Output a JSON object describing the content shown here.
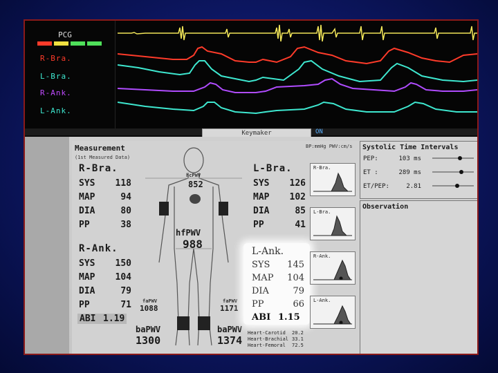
{
  "monitor": {
    "channel_title": "PCG",
    "channels": [
      {
        "label": "R-Bra.",
        "color": "#ff3b2a"
      },
      {
        "label": "L-Bra.",
        "color": "#3ee8d0"
      },
      {
        "label": "R-Ank.",
        "color": "#c04bff"
      },
      {
        "label": "L-Ank.",
        "color": "#3ee8d0"
      }
    ],
    "toolbar_text": "Keymaker",
    "toolbar_status": "ON"
  },
  "report": {
    "measurement_title": "Measurement",
    "measurement_sub": "(1st Measured Data)",
    "units": "BP:mmHg PWV:cm/s",
    "r_bra": {
      "title": "R-Bra.",
      "rows": [
        [
          "SYS",
          "118"
        ],
        [
          "MAP",
          "94"
        ],
        [
          "DIA",
          "80"
        ],
        [
          "PP",
          "38"
        ]
      ]
    },
    "r_ank": {
      "title": "R-Ank.",
      "rows": [
        [
          "SYS",
          "150"
        ],
        [
          "MAP",
          "104"
        ],
        [
          "DIA",
          "79"
        ],
        [
          "PP",
          "71"
        ]
      ],
      "abi_label": "ABI",
      "abi_value": "1.19"
    },
    "l_bra": {
      "title": "L-Bra.",
      "rows": [
        [
          "SYS",
          "126"
        ],
        [
          "MAP",
          "102"
        ],
        [
          "DIA",
          "85"
        ],
        [
          "PP",
          "41"
        ]
      ]
    },
    "l_ank": {
      "title": "L-Ank.",
      "rows": [
        [
          "SYS",
          "145"
        ],
        [
          "MAP",
          "104"
        ],
        [
          "DIA",
          "79"
        ],
        [
          "PP",
          "66"
        ]
      ],
      "abi_label": "ABI",
      "abi_value": "1.15"
    },
    "pwv": {
      "hcPWV": {
        "label": "hcPWV",
        "value": "852"
      },
      "hfPWV": {
        "label": "hfPWV",
        "value": "988"
      },
      "faPWV_r": {
        "label": "faPWV",
        "value": "1088"
      },
      "faPWV_l": {
        "label": "faPWV",
        "value": "1171"
      },
      "baPWV_r": {
        "label": "baPWV",
        "value": "1300"
      },
      "baPWV_l": {
        "label": "baPWV",
        "value": "1374"
      }
    },
    "graphs": [
      "R-Bra.",
      "L-Bra.",
      "R-Ank.",
      "L-Ank."
    ],
    "sti": {
      "title": "Systolic Time Intervals",
      "rows": [
        [
          "PEP:",
          "103 ms"
        ],
        [
          "ET :",
          "289 ms"
        ],
        [
          "ET/PEP:",
          "2.81"
        ]
      ]
    },
    "observation_title": "Observation",
    "distances": [
      [
        "Heart-Carotid",
        "20.2"
      ],
      [
        "Heart-Brachial",
        "33.1"
      ],
      [
        "Heart-Femoral",
        "72.5"
      ]
    ]
  }
}
